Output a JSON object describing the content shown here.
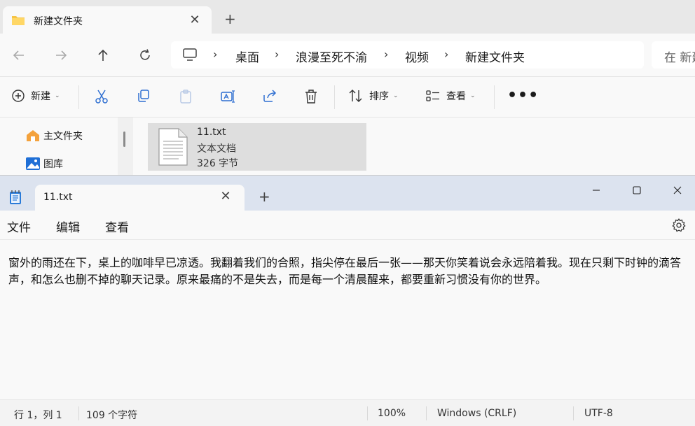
{
  "colors": {
    "explorer_tabbar_bg": "#e8e8e8",
    "notepad_titlebar_bg": "#dce3ef",
    "selected_file_bg": "#dedede",
    "folder_yellow": "#f6c445",
    "accent_blue": "#2f6fd1"
  },
  "explorer": {
    "tab": {
      "title": "新建文件夹",
      "icon": "folder-icon"
    },
    "nav": {
      "back_icon": "back-arrow-icon",
      "forward_icon": "forward-arrow-icon",
      "up_icon": "up-arrow-icon",
      "refresh_icon": "refresh-icon"
    },
    "breadcrumb": [
      "桌面",
      "浪漫至死不渝",
      "视频",
      "新建文件夹"
    ],
    "search_placeholder": "在 新建文件夹 中搜索",
    "toolbar": {
      "new_label": "新建",
      "sort_label": "排序",
      "view_label": "查看",
      "more_label": "•••"
    },
    "sidebar": [
      {
        "label": "主文件夹",
        "icon": "home-icon"
      },
      {
        "label": "图库",
        "icon": "gallery-icon"
      }
    ],
    "file": {
      "name": "11.txt",
      "type": "文本文档",
      "size": "326 字节"
    }
  },
  "notepad": {
    "tab_title": "11.txt",
    "menu": [
      "文件",
      "编辑",
      "查看"
    ],
    "content": "窗外的雨还在下，桌上的咖啡早已凉透。我翻着我们的合照，指尖停在最后一张——那天你笑着说会永远陪着我。现在只剩下时钟的滴答声，和怎么也删不掉的聊天记录。原来最痛的不是失去，而是每一个清晨醒来，都要重新习惯没有你的世界。",
    "status": {
      "position": "行 1，列 1",
      "chars": "109 个字符",
      "zoom": "100%",
      "line_ending": "Windows (CRLF)",
      "encoding": "UTF-8"
    }
  }
}
